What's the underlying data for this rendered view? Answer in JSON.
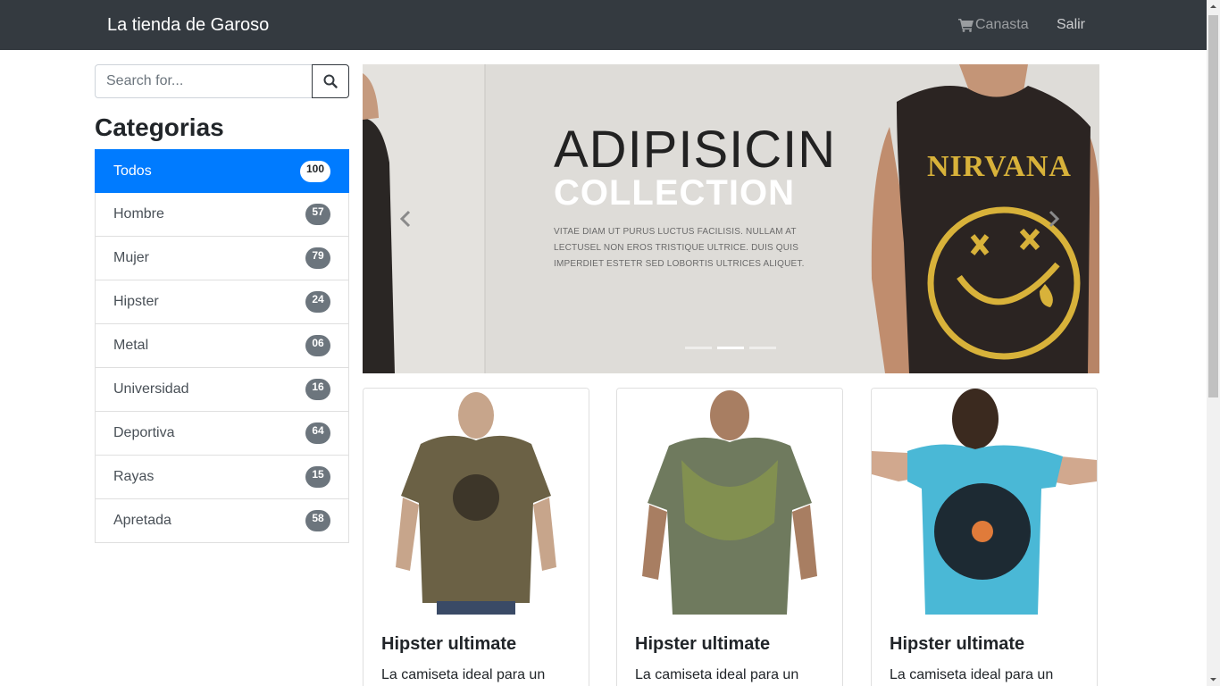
{
  "navbar": {
    "brand": "La tienda de Garoso",
    "cart_label": "Canasta",
    "logout_label": "Salir"
  },
  "search": {
    "placeholder": "Search for..."
  },
  "categories": {
    "title": "Categorias",
    "items": [
      {
        "label": "Todos",
        "count": "100"
      },
      {
        "label": "Hombre",
        "count": "57"
      },
      {
        "label": "Mujer",
        "count": "79"
      },
      {
        "label": "Hipster",
        "count": "24"
      },
      {
        "label": "Metal",
        "count": "06"
      },
      {
        "label": "Universidad",
        "count": "16"
      },
      {
        "label": "Deportiva",
        "count": "64"
      },
      {
        "label": "Rayas",
        "count": "15"
      },
      {
        "label": "Apretada",
        "count": "58"
      }
    ]
  },
  "carousel": {
    "title": "ADIPISICIN",
    "subtitle": "COLLECTION",
    "description": "VITAE DIAM UT PURUS LUCTUS FACILISIS. NULLAM AT LECTUSEL NON EROS TRISTIQUE ULTRICE. DUIS QUIS IMPERDIET ESTETR SED LOBORTIS ULTRICES ALIQUET.",
    "shirt_print": "NIRVANA",
    "slide_count": 3,
    "active_slide": 2
  },
  "products": [
    {
      "title": "Hipster ultimate",
      "text": "La camiseta ideal para un",
      "color": "#6b6145"
    },
    {
      "title": "Hipster ultimate",
      "text": "La camiseta ideal para un",
      "color": "#6f7a5e"
    },
    {
      "title": "Hipster ultimate",
      "text": "La camiseta ideal para un",
      "color": "#4ab8d6"
    }
  ],
  "colors": {
    "navbar_bg": "#343a40",
    "active": "#007bff",
    "badge": "#6c757d"
  }
}
